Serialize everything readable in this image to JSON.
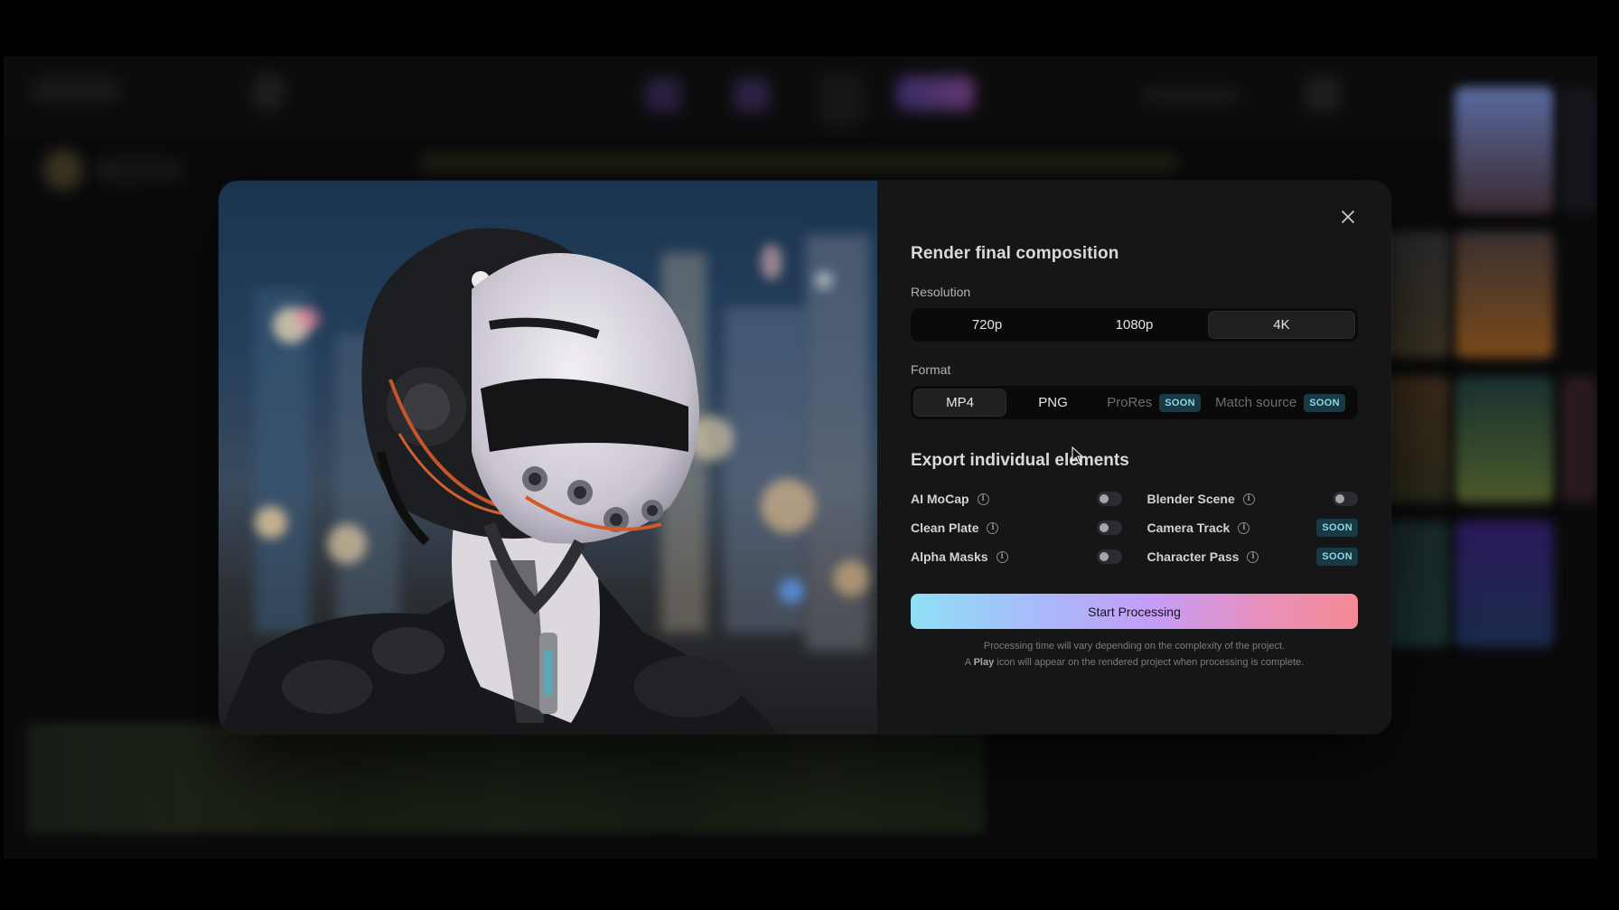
{
  "modal": {
    "title": "Render final composition",
    "close_icon": "close-icon",
    "resolution": {
      "label": "Resolution",
      "options": [
        "720p",
        "1080p",
        "4K"
      ],
      "selected": "4K"
    },
    "format": {
      "label": "Format",
      "options": [
        {
          "label": "MP4",
          "badge": ""
        },
        {
          "label": "PNG",
          "badge": ""
        },
        {
          "label": "ProRes",
          "badge": "SOON"
        },
        {
          "label": "Match source",
          "badge": "SOON"
        }
      ],
      "selected": "MP4"
    },
    "elements": {
      "title": "Export individual elements",
      "left": [
        {
          "label": "AI MoCap",
          "control": "toggle",
          "on": false
        },
        {
          "label": "Clean Plate",
          "control": "toggle",
          "on": false
        },
        {
          "label": "Alpha Masks",
          "control": "toggle",
          "on": false
        }
      ],
      "right": [
        {
          "label": "Blender Scene",
          "control": "toggle",
          "on": false
        },
        {
          "label": "Camera Track",
          "control": "badge",
          "badge": "SOON"
        },
        {
          "label": "Character Pass",
          "control": "badge",
          "badge": "SOON"
        }
      ]
    },
    "start_button": "Start Processing",
    "note_line1": "Processing time will vary depending on the complexity of the project.",
    "note_line2_prefix": "A ",
    "note_line2_bold": "Play",
    "note_line2_suffix": " icon will appear on the rendered project when processing is complete."
  },
  "colors": {
    "panel_bg": "#151618",
    "segment_track": "#0a0a0b",
    "soon_badge_bg": "#173a44",
    "soon_badge_text": "#8fd4e6",
    "button_gradient": [
      "#8fe0f5",
      "#c69cf6",
      "#f38a94"
    ]
  }
}
